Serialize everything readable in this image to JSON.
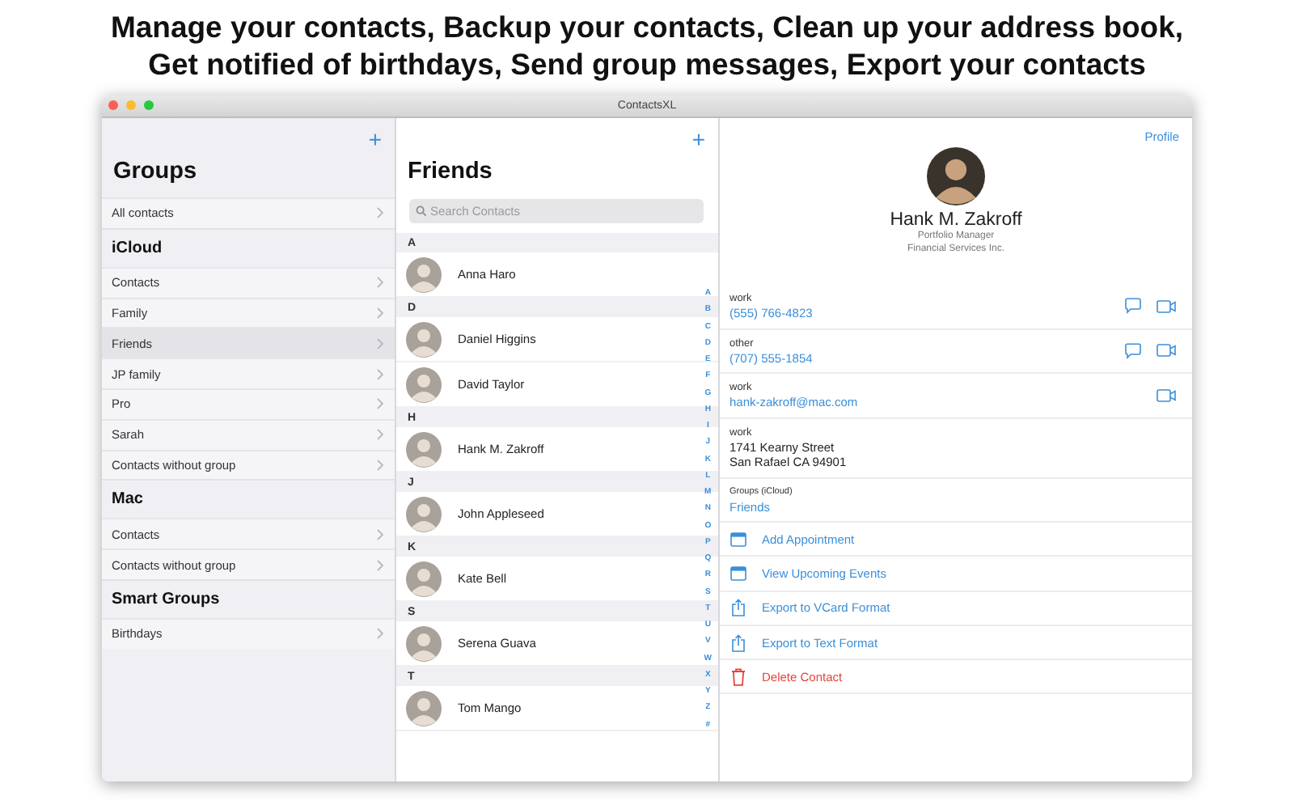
{
  "headline": [
    "Manage your contacts, Backup your contacts, Clean up your address book,",
    "Get notified of birthdays, Send group messages, Export your contacts"
  ],
  "window": {
    "title": "ContactsXL"
  },
  "groups": {
    "add": "+",
    "title": "Groups",
    "sections": [
      {
        "items": [
          {
            "label": "All contacts",
            "selected": false
          }
        ]
      },
      {
        "header": "iCloud",
        "items": [
          {
            "label": "Contacts",
            "selected": false
          },
          {
            "label": "Family",
            "selected": false
          },
          {
            "label": "Friends",
            "selected": true
          },
          {
            "label": "JP family",
            "selected": false
          },
          {
            "label": "Pro",
            "selected": false
          },
          {
            "label": "Sarah",
            "selected": false
          },
          {
            "label": "Contacts without group",
            "selected": false
          }
        ]
      },
      {
        "header": "Mac",
        "items": [
          {
            "label": "Contacts",
            "selected": false
          },
          {
            "label": "Contacts without group",
            "selected": false
          }
        ]
      },
      {
        "header": "Smart Groups",
        "items": [
          {
            "label": "Birthdays",
            "selected": false
          }
        ]
      }
    ]
  },
  "contacts": {
    "add": "+",
    "title": "Friends",
    "search": {
      "placeholder": "Search Contacts"
    },
    "sections": [
      {
        "letter": "A",
        "names": [
          "Anna Haro"
        ]
      },
      {
        "letter": "D",
        "names": [
          "Daniel Higgins",
          "David Taylor"
        ]
      },
      {
        "letter": "H",
        "names": [
          "Hank M. Zakroff"
        ]
      },
      {
        "letter": "J",
        "names": [
          "John Appleseed"
        ]
      },
      {
        "letter": "K",
        "names": [
          "Kate Bell"
        ]
      },
      {
        "letter": "S",
        "names": [
          "Serena Guava"
        ]
      },
      {
        "letter": "T",
        "names": [
          "Tom Mango"
        ]
      }
    ],
    "index": [
      "A",
      "B",
      "C",
      "D",
      "E",
      "F",
      "G",
      "H",
      "I",
      "J",
      "K",
      "L",
      "M",
      "N",
      "O",
      "P",
      "Q",
      "R",
      "S",
      "T",
      "U",
      "V",
      "W",
      "X",
      "Y",
      "Z",
      "#"
    ]
  },
  "detail": {
    "profile": "Profile",
    "name": "Hank M. Zakroff",
    "job_title": "Portfolio Manager",
    "company": "Financial Services Inc.",
    "fields": [
      {
        "kind": "phone",
        "label": "work",
        "lines": [
          "(555) 766-4823"
        ],
        "message": true,
        "video": true
      },
      {
        "kind": "phone",
        "label": "other",
        "lines": [
          "(707) 555-1854"
        ],
        "message": true,
        "video": true
      },
      {
        "kind": "email",
        "label": "work",
        "lines": [
          "hank-zakroff@mac.com"
        ],
        "message": false,
        "video": true
      },
      {
        "kind": "address",
        "label": "work",
        "lines": [
          "1741 Kearny Street",
          "San Rafael CA 94901"
        ],
        "message": false,
        "video": false
      },
      {
        "kind": "group",
        "label": "Groups (iCloud)",
        "lines": [
          "Friends"
        ],
        "message": false,
        "video": false
      }
    ],
    "actions": [
      {
        "kind": "calendar",
        "label": "Add Appointment"
      },
      {
        "kind": "calendar",
        "label": "View Upcoming Events"
      },
      {
        "kind": "share",
        "label": "Export to VCard Format"
      },
      {
        "kind": "share",
        "label": "Export to Text Format"
      },
      {
        "kind": "delete",
        "label": "Delete Contact"
      }
    ]
  }
}
